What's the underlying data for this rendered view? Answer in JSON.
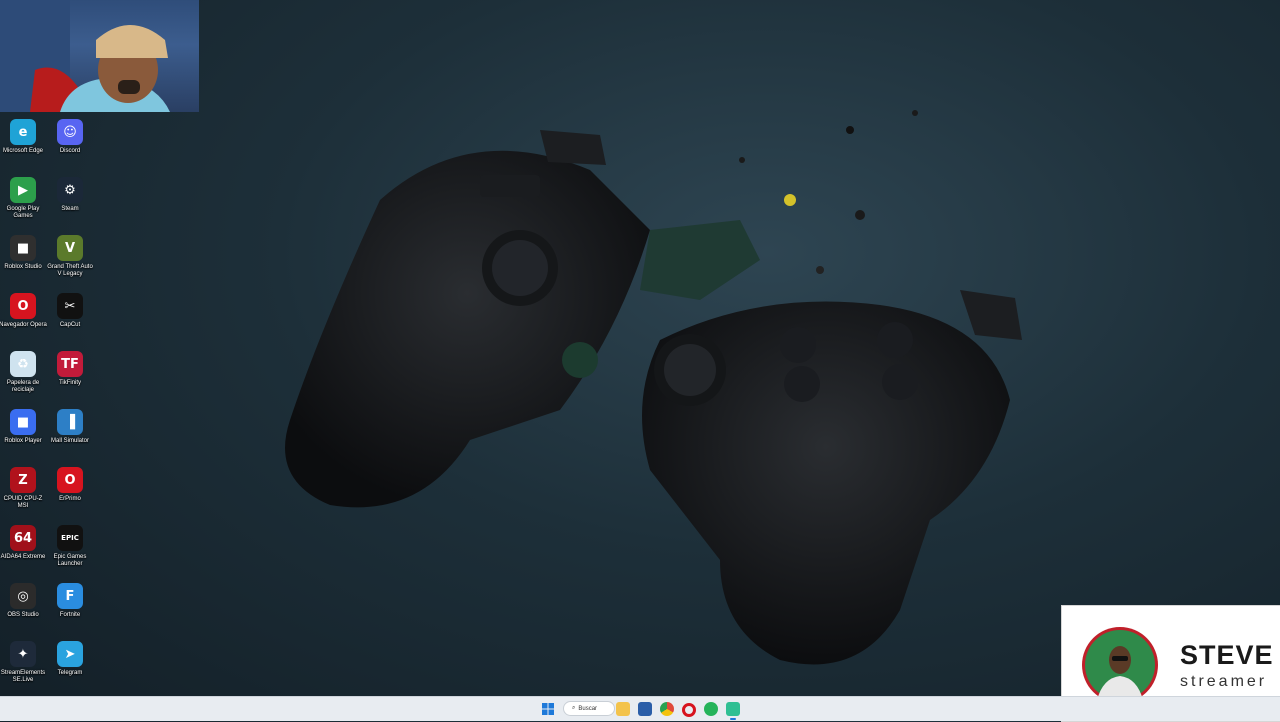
{
  "desktop": {
    "icons": [
      {
        "label": "Microsoft Edge",
        "icon": "edge-icon",
        "color": "#1fa3d6"
      },
      {
        "label": "Discord",
        "icon": "discord-icon",
        "color": "#5865f2"
      },
      {
        "label": "Google Play Games",
        "icon": "google-play-games-icon",
        "color": "#2c9f4b"
      },
      {
        "label": "Steam",
        "icon": "steam-icon",
        "color": "#1b2838"
      },
      {
        "label": "Roblox Studio",
        "icon": "roblox-studio-icon",
        "color": "#2f2f2f"
      },
      {
        "label": "Grand Theft Auto V Legacy",
        "icon": "gta-v-icon",
        "color": "#5b7a2b"
      },
      {
        "label": "Navegador Opera",
        "icon": "opera-icon",
        "color": "#d7141f"
      },
      {
        "label": "CapCut",
        "icon": "capcut-icon",
        "color": "#111111"
      },
      {
        "label": "Papelera de reciclaje",
        "icon": "recycle-bin-icon",
        "color": "#cfe3ef"
      },
      {
        "label": "TikFinity",
        "icon": "tikfinity-icon",
        "color": "#c21b3a"
      },
      {
        "label": "Roblox Player",
        "icon": "roblox-player-icon",
        "color": "#3a6df0"
      },
      {
        "label": "Mall Simulator",
        "icon": "mall-simulator-icon",
        "color": "#2d7fc6"
      },
      {
        "label": "CPUID CPU-Z MSI",
        "icon": "cpuz-icon",
        "color": "#b1121c"
      },
      {
        "label": "ErPrimo",
        "icon": "erprimo-icon",
        "color": "#d7141f"
      },
      {
        "label": "AIDA64 Extreme",
        "icon": "aida64-icon",
        "color": "#a0101a"
      },
      {
        "label": "Epic Games Launcher",
        "icon": "epic-games-icon",
        "color": "#111111"
      },
      {
        "label": "OBS Studio",
        "icon": "obs-icon",
        "color": "#2b2b2b"
      },
      {
        "label": "Fortnite",
        "icon": "fortnite-icon",
        "color": "#2a8de0"
      },
      {
        "label": "StreamElements SE.Live",
        "icon": "streamelements-icon",
        "color": "#1e2a3a"
      },
      {
        "label": "Telegram",
        "icon": "telegram-icon",
        "color": "#2aa3df"
      }
    ]
  },
  "taskbar": {
    "search_label": "Buscar",
    "apps": [
      {
        "name": "start",
        "icon": "windows-start-icon",
        "color": "#1e79d9"
      },
      {
        "name": "file-explorer",
        "icon": "folder-icon",
        "color": "#f3c34c"
      },
      {
        "name": "unknown-app",
        "icon": "app-window-icon",
        "color": "#2b5ea8"
      },
      {
        "name": "chrome",
        "icon": "chrome-icon",
        "color": "#e04a3b"
      },
      {
        "name": "opera",
        "icon": "opera-icon",
        "color": "#d7141f"
      },
      {
        "name": "whatsapp",
        "icon": "whatsapp-icon",
        "color": "#25b35a"
      },
      {
        "name": "streamlabs",
        "icon": "streamlabs-icon",
        "color": "#2fbf93"
      }
    ]
  },
  "streamer_card": {
    "name": "STEVE",
    "role": "streamer",
    "accent": "#c0202a"
  }
}
